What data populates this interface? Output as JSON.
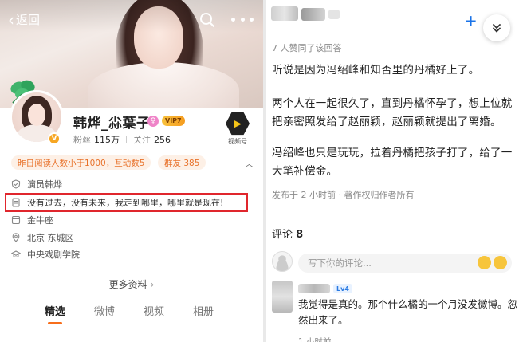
{
  "left_panel": {
    "nav": {
      "back_label": "返回"
    },
    "profile": {
      "name": "韩烨_尛葉子",
      "fans_label": "粉丝",
      "fans_value": "115万",
      "follow_label": "关注",
      "follow_value": "256",
      "vip_label": "VIP7",
      "video_badge_label": "视频号"
    },
    "tags": {
      "reader_notice": "昨日阅读人数小于1000，互动数5",
      "fan_group": "群友 385"
    },
    "info_items": [
      {
        "icon": "verified-shield-icon",
        "text": "演员韩烨"
      },
      {
        "icon": "bio-document-icon",
        "text": "没有过去，没有未来，我走到哪里，哪里就是现在!"
      },
      {
        "icon": "constellation-icon",
        "text": "金牛座"
      },
      {
        "icon": "location-pin-icon",
        "text": "北京 东城区"
      },
      {
        "icon": "education-cap-icon",
        "text": "中央戏剧学院"
      }
    ],
    "more_link": "更多资料",
    "tabs": [
      "精选",
      "微博",
      "视频",
      "相册"
    ],
    "highlight_color": "#e0262d",
    "accent_color": "#f76e1b"
  },
  "right_panel": {
    "likes_line": "7 人赞同了该回答",
    "answer": {
      "p1": "听说是因为冯绍峰和知否里的丹橘好上了。",
      "p2": "两个人在一起很久了，直到丹橘怀孕了，想上位就把亲密照发给了赵丽颖，赵丽颖就提出了离婚。",
      "p3": "冯绍峰也只是玩玩，拉着丹橘把孩子打了，给了一大笔补偿金。"
    },
    "published": "发布于 2 小时前 · 著作权归作者所有",
    "comments_label": "评论",
    "comments_count": "8",
    "comment_input_placeholder": "写下你的评论...",
    "reply": {
      "level_badge": "Lv4",
      "text": "我觉得是真的。那个什么橘的一个月没发微博。忽然出来了。",
      "meta": "1 小时前"
    },
    "link_color": "#1a73e8"
  }
}
